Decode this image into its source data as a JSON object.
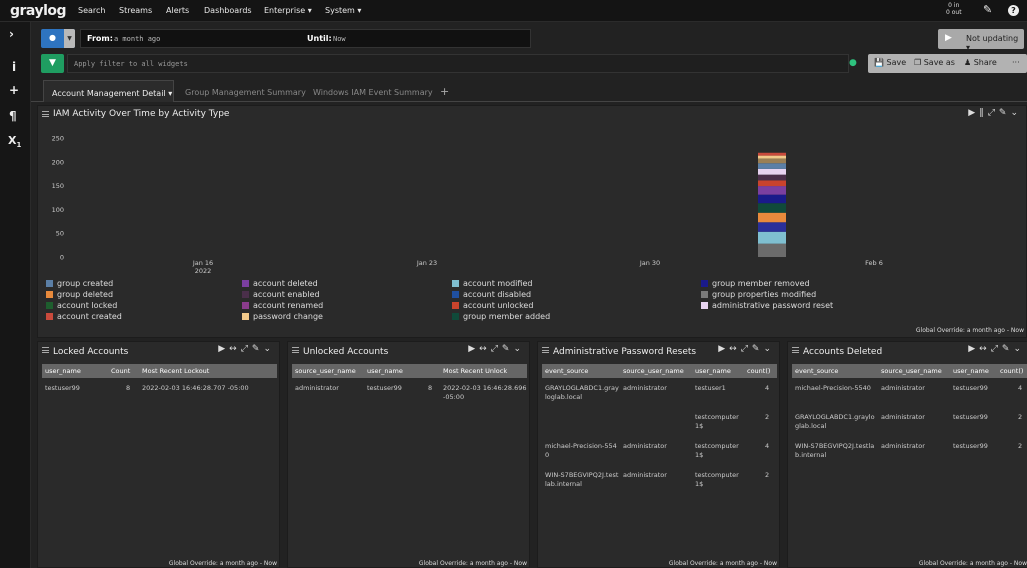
{
  "nav": {
    "logo": "graylog",
    "items": [
      "Search",
      "Streams",
      "Alerts",
      "Dashboards",
      "Enterprise ▾",
      "System ▾"
    ],
    "throughput_in": "0 in",
    "throughput_out": "0 out"
  },
  "search": {
    "from_label": "From:",
    "from_value": "a month ago",
    "until_label": "Until:",
    "until_value": "Now",
    "filter_placeholder": "Apply filter to all widgets",
    "not_updating": "Not updating ▾",
    "save": "Save",
    "save_as": "Save as",
    "share": "Share",
    "more": "···"
  },
  "tabs": [
    "Account Management Detail ▾",
    "Group Management Summary",
    "Windows IAM Event Summary"
  ],
  "chart_widget": {
    "title": "IAM Activity Over Time by Activity Type",
    "footer": "Global Override: a month ago - Now"
  },
  "chart_data": {
    "type": "bar",
    "stacked": true,
    "y_ticks": [
      "0",
      "50",
      "100",
      "150",
      "200",
      "250"
    ],
    "ylim": [
      0,
      250
    ],
    "x_ticks": [
      {
        "label": "Jan 16",
        "sub": "2022"
      },
      {
        "label": "Jan 23",
        "sub": ""
      },
      {
        "label": "Jan 30",
        "sub": ""
      },
      {
        "label": "Feb 6",
        "sub": ""
      }
    ],
    "bar_date": "2022-02-03",
    "series": [
      {
        "name": "group created",
        "color": "#5b7fa6",
        "value": 28
      },
      {
        "name": "account deleted",
        "color": "#7b3fa0",
        "value": 0
      },
      {
        "name": "account modified",
        "color": "#7fbfd0",
        "value": 25
      },
      {
        "name": "group member removed",
        "color": "#1a1a8a",
        "value": 0
      },
      {
        "name": "group deleted",
        "color": "#e88a3c",
        "value": 20
      },
      {
        "name": "account enabled",
        "color": "#4a2f4a",
        "value": 0
      },
      {
        "name": "account disabled",
        "color": "#1f4f9f",
        "value": 20
      },
      {
        "name": "group properties modified",
        "color": "#7a7a7a",
        "value": 0
      },
      {
        "name": "account locked",
        "color": "#1e5e2e",
        "value": 18
      },
      {
        "name": "account renamed",
        "color": "#8a3c8c",
        "value": 0
      },
      {
        "name": "account unlocked",
        "color": "#c9432c",
        "value": 18
      },
      {
        "name": "administrative password reset",
        "color": "#e7d3f0",
        "value": 12
      },
      {
        "name": "account created",
        "color": "#c94a3c",
        "value": 17
      },
      {
        "name": "password change",
        "color": "#f2c98a",
        "value": 0
      },
      {
        "name": "group member added",
        "color": "#104a3a",
        "value": 20
      }
    ],
    "stack_order": [
      {
        "color": "#6b6b6b",
        "value": 28
      },
      {
        "color": "#7fbfd0",
        "value": 25
      },
      {
        "color": "#2a2f9a",
        "value": 20
      },
      {
        "color": "#e88a3c",
        "value": 20
      },
      {
        "color": "#104a3a",
        "value": 20
      },
      {
        "color": "#1a1a8a",
        "value": 18
      },
      {
        "color": "#7b3fa0",
        "value": 18
      },
      {
        "color": "#c9432c",
        "value": 12
      },
      {
        "color": "#4a2f4a",
        "value": 12
      },
      {
        "color": "#e7d3f0",
        "value": 12
      },
      {
        "color": "#5b7fa6",
        "value": 12
      },
      {
        "color": "#9a7f55",
        "value": 10
      },
      {
        "color": "#f2c98a",
        "value": 6
      },
      {
        "color": "#c94a3c",
        "value": 6
      }
    ]
  },
  "tables": [
    {
      "title": "Locked Accounts",
      "columns": [
        [
          "user_name",
          0
        ],
        [
          "Count",
          66
        ],
        [
          "Most Recent Lockout",
          97
        ]
      ],
      "rows": [
        [
          [
            "testuser99",
            0,
            0
          ],
          [
            "8",
            81,
            0
          ],
          [
            "2022-02-03 16:46:28.707 -05:00",
            97,
            0
          ]
        ]
      ],
      "footer": "Global Override: a month ago - Now"
    },
    {
      "title": "Unlocked Accounts",
      "columns": [
        [
          "source_user_name",
          0
        ],
        [
          "user_name",
          72
        ],
        [
          "Most Recent Unlock",
          148
        ]
      ],
      "rows": [
        [
          [
            "administrator",
            0,
            0
          ],
          [
            "testuser99",
            72,
            0
          ],
          [
            "8",
            133,
            0
          ],
          [
            "2022-02-03 16:46:28.696\n-05:00",
            148,
            0
          ]
        ]
      ],
      "footer": "Global Override: a month ago - Now"
    },
    {
      "title": "Administrative Password Resets",
      "columns": [
        [
          "event_source",
          0
        ],
        [
          "source_user_name",
          78
        ],
        [
          "user_name",
          150
        ],
        [
          "count()",
          202
        ]
      ],
      "rows": [
        [
          [
            "GRAYLOGLABDC1.gray\nloglab.local",
            0,
            0
          ],
          [
            "administrator",
            78,
            0
          ],
          [
            "testuser1",
            150,
            0
          ],
          [
            "4",
            220,
            0
          ]
        ],
        [
          [
            "testcomputer\n1$",
            150,
            29
          ],
          [
            "2",
            220,
            29
          ]
        ],
        [
          [
            "michael-Precision-554\n0",
            0,
            58
          ],
          [
            "administrator",
            78,
            58
          ],
          [
            "testcomputer\n1$",
            150,
            58
          ],
          [
            "4",
            220,
            58
          ]
        ],
        [
          [
            "WIN-S7BEGVIPQ2J.test\nlab.internal",
            0,
            87
          ],
          [
            "administrator",
            78,
            87
          ],
          [
            "testcomputer\n1$",
            150,
            87
          ],
          [
            "2",
            220,
            87
          ]
        ]
      ],
      "footer": "Global Override: a month ago - Now"
    },
    {
      "title": "Accounts Deleted",
      "columns": [
        [
          "event_source",
          0
        ],
        [
          "source_user_name",
          86
        ],
        [
          "user_name",
          158
        ],
        [
          "count()",
          205
        ]
      ],
      "rows": [
        [
          [
            "michael-Precision-5540",
            0,
            0
          ],
          [
            "administrator",
            86,
            0
          ],
          [
            "testuser99",
            158,
            0
          ],
          [
            "4",
            223,
            0
          ]
        ],
        [
          [
            "GRAYLOGLABDC1.graylo\nglab.local",
            0,
            29
          ],
          [
            "administrator",
            86,
            29
          ],
          [
            "testuser99",
            158,
            29
          ],
          [
            "2",
            223,
            29
          ]
        ],
        [
          [
            "WIN-S7BEGVIPQ2J.testla\nb.internal",
            0,
            58
          ],
          [
            "administrator",
            86,
            58
          ],
          [
            "testuser99",
            158,
            58
          ],
          [
            "2",
            223,
            58
          ]
        ]
      ],
      "footer": "Global Override: a month ago - Now"
    }
  ],
  "colors": {
    "accent": "#2e74c0",
    "filter": "#1f9d61"
  }
}
